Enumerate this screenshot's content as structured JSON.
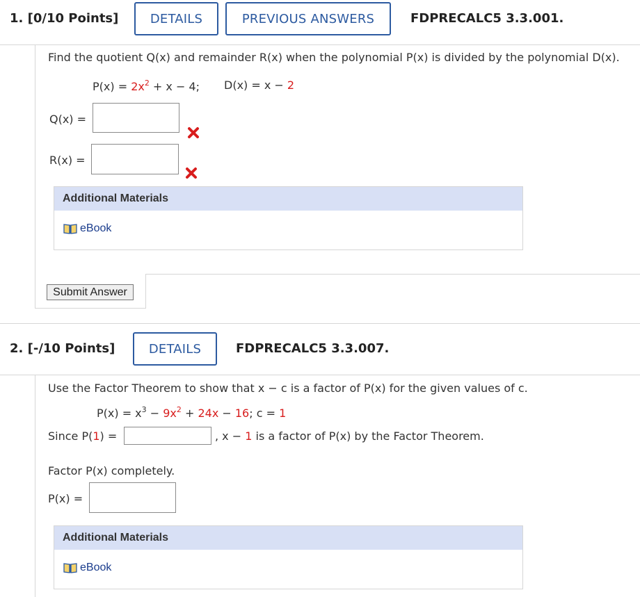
{
  "q1": {
    "number_points": "1. [0/10 Points]",
    "details_label": "DETAILS",
    "prev_answers_label": "PREVIOUS ANSWERS",
    "code": "FDPRECALC5 3.3.001.",
    "instruction": "Find the quotient Q(x) and remainder R(x) when the polynomial P(x) is divided by the polynomial D(x).",
    "eq_p_prefix": "P(x) = ",
    "eq_p_coef": "2x",
    "eq_p_exp": "2",
    "eq_p_tail": " + x − 4;",
    "eq_d_prefix": "D(x) = x − ",
    "eq_d_val": "2",
    "q_label": "Q(x) =",
    "q_value": "",
    "r_label": "R(x) =",
    "r_value": "",
    "q_status": "incorrect",
    "r_status": "incorrect",
    "additional_materials": "Additional Materials",
    "ebook": "eBook",
    "submit_label": "Submit Answer"
  },
  "q2": {
    "number_points": "2. [-/10 Points]",
    "details_label": "DETAILS",
    "code": "FDPRECALC5 3.3.007.",
    "instruction": "Use the Factor Theorem to show that x − c is a factor of P(x) for the given values of c.",
    "eq_prefix": "P(x) = x",
    "eq_exp3": "3",
    "eq_mid1": " − ",
    "eq_9x": "9x",
    "eq_exp2": "2",
    "eq_mid2": " + ",
    "eq_24x": "24x",
    "eq_mid3": " − ",
    "eq_16": "16",
    "eq_c_prefix": "; c = ",
    "eq_c_val": "1",
    "since_prefix": "Since P(",
    "since_val": "1",
    "since_suffix": ") =",
    "since_value": "",
    "factor_prefix": ", x − ",
    "factor_val": "1",
    "factor_suffix": " is a factor of P(x) by the Factor Theorem.",
    "factor_instruction": "Factor P(x) completely.",
    "p_label": "P(x) =",
    "p_value": "",
    "additional_materials": "Additional Materials",
    "ebook": "eBook"
  },
  "colors": {
    "accent": "#2c5aa0",
    "red": "#d81d1d",
    "header_bg": "#d8e0f5",
    "link": "#1a3c8c"
  }
}
